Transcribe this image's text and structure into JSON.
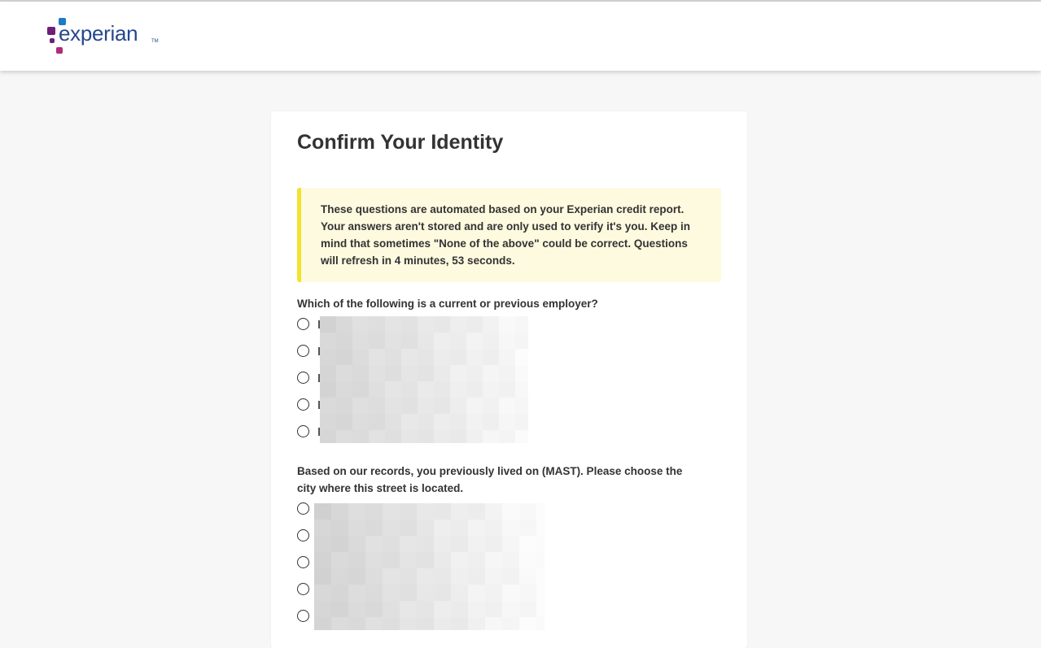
{
  "header": {
    "logo_text": "experian",
    "logo_tm": "TM",
    "logo_icon": "experian-dots-icon",
    "colors": {
      "blue": "#1d7bc6",
      "purple": "#6d2077",
      "magenta": "#b12a7c",
      "wordmark": "#26478d"
    }
  },
  "page": {
    "title": "Confirm Your Identity",
    "notice": "These questions are automated based on your Experian credit report. Your answers aren't stored and are only used to verify it's you. Keep in mind that sometimes \"None of the above\" could be correct. Questions will refresh in 4 minutes, 53 seconds.",
    "notice_accent": "#f3e22c"
  },
  "questions": [
    {
      "prompt": "Which of the following is a current or previous employer?",
      "options_count": 5,
      "options_redacted": true
    },
    {
      "prompt": "Based on our records, you previously lived on (MAST). Please choose the city where this street is located.",
      "options_count": 5,
      "options_redacted": true
    }
  ]
}
